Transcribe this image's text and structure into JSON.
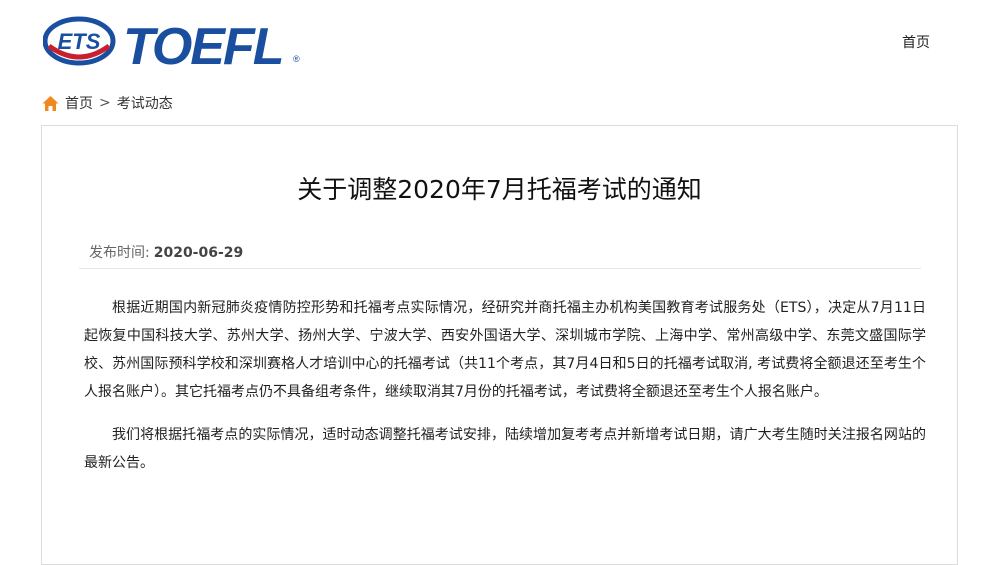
{
  "header": {
    "logo": {
      "ets_text": "ETS",
      "brand_text": "TOEFL",
      "trademark": "®",
      "icon": "ets-toefl-logo"
    },
    "nav_home_label": "首页"
  },
  "breadcrumb": {
    "icon": "home-icon",
    "home_label": "首页",
    "separator": ">",
    "current_label": "考试动态"
  },
  "article": {
    "title": "关于调整2020年7月托福考试的通知",
    "published_label": "发布时间:",
    "published_date": "2020-06-29",
    "paragraphs": [
      "根据近期国内新冠肺炎疫情防控形势和托福考点实际情况，经研究并商托福主办机构美国教育考试服务处（ETS），决定从7月11日起恢复中国科技大学、苏州大学、扬州大学、宁波大学、西安外国语大学、深圳城市学院、上海中学、常州高级中学、东莞文盛国际学校、苏州国际预科学校和深圳赛格人才培训中心的托福考试（共11个考点，其7月4日和5日的托福考试取消, 考试费将全额退还至考生个人报名账户）。其它托福考点仍不具备组考条件，继续取消其7月份的托福考试，考试费将全额退还至考生个人报名账户。",
      "我们将根据托福考点的实际情况，适时动态调整托福考试安排，陆续增加复考考点并新增考试日期，请广大考生随时关注报名网站的最新公告。"
    ]
  },
  "colors": {
    "ets_blue": "#1a4fa0",
    "ets_red": "#c8202f",
    "home_icon_orange": "#f08a1c",
    "border": "#dcdcdc"
  }
}
